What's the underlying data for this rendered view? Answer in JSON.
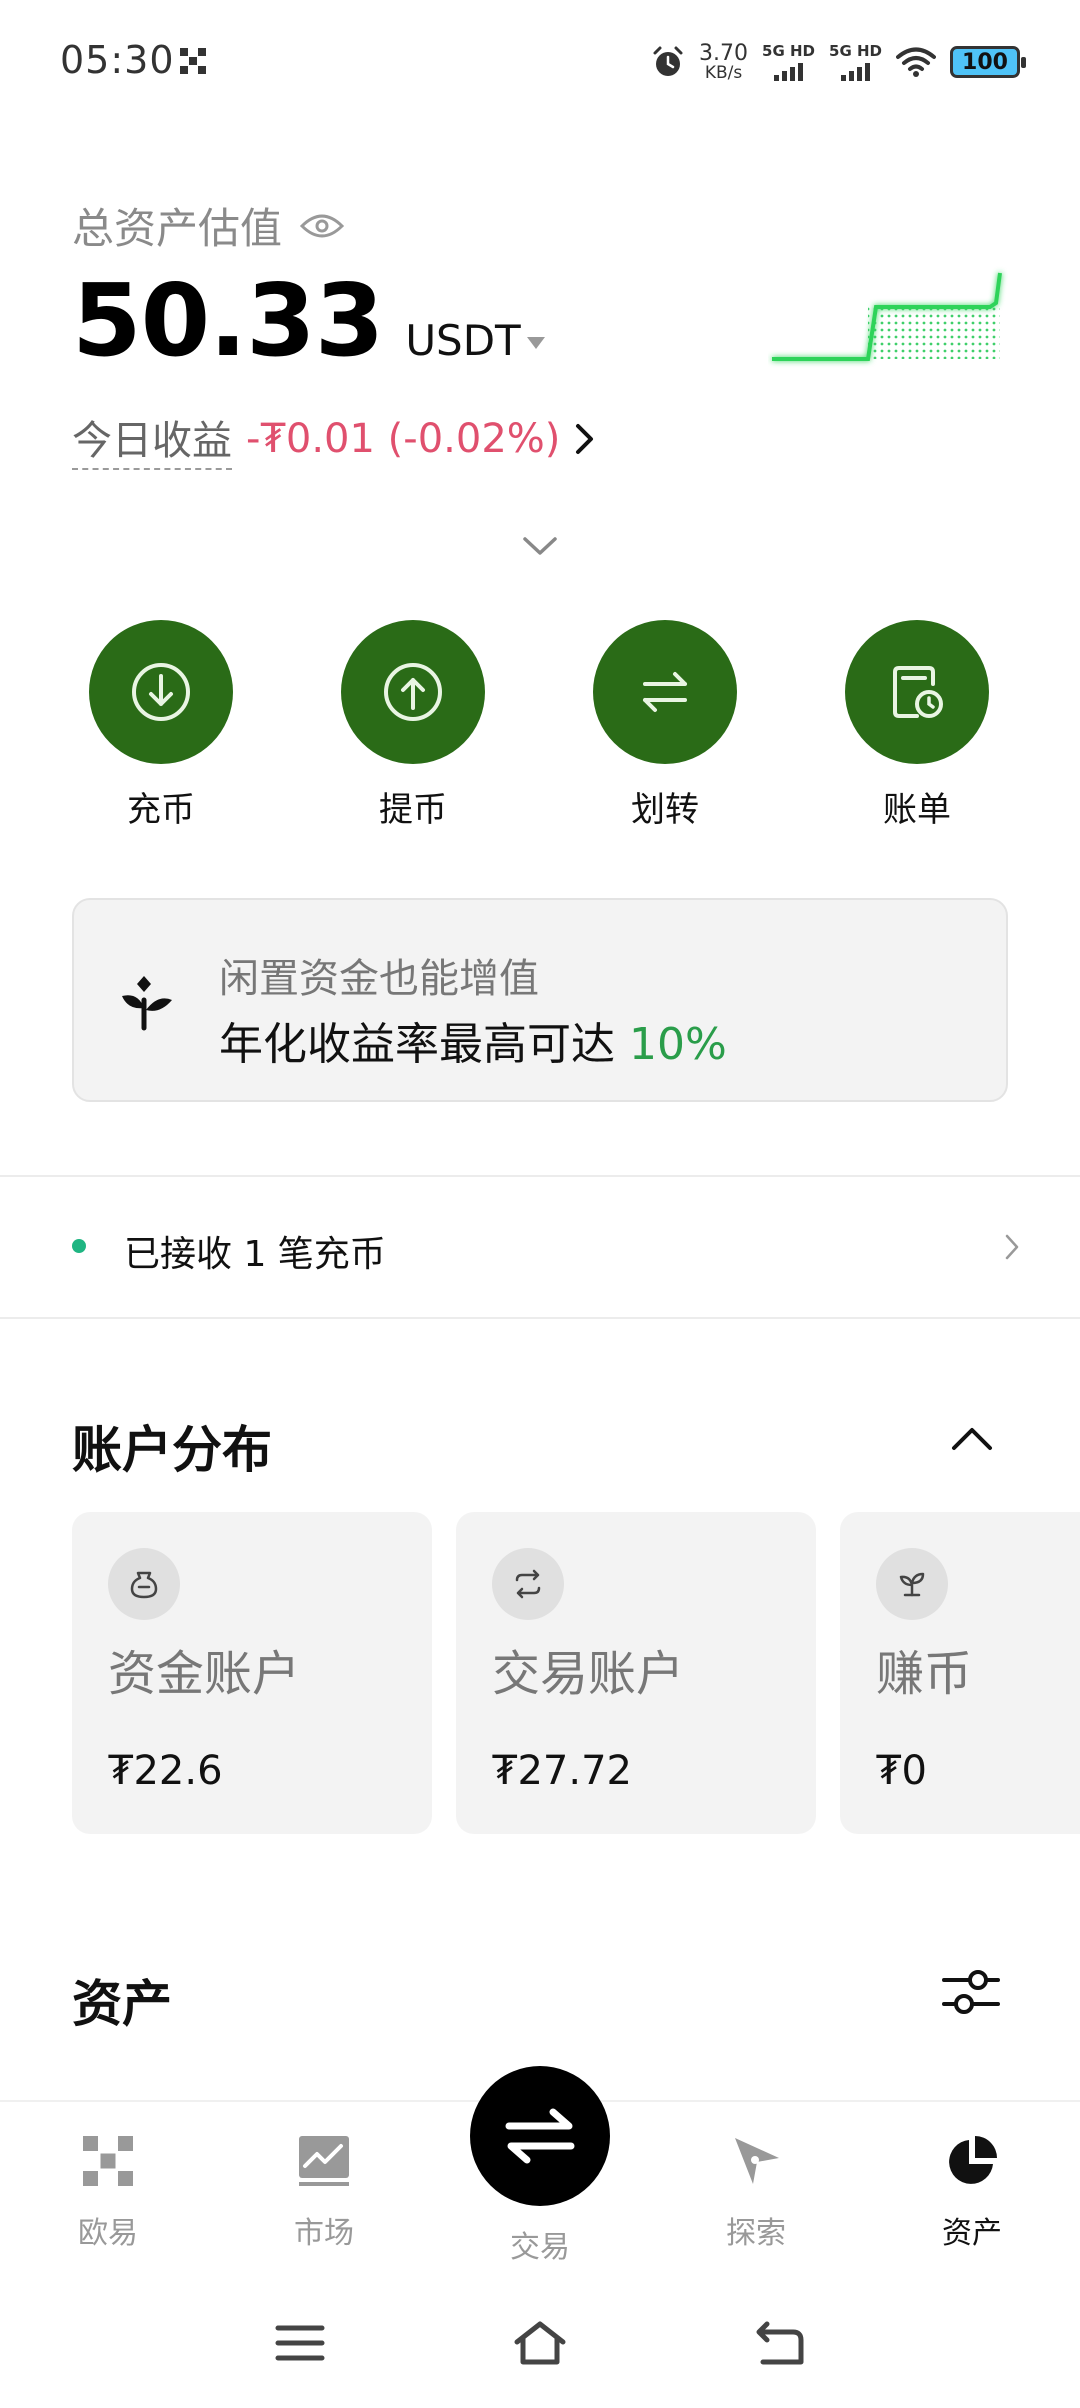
{
  "status_bar": {
    "time": "05:30",
    "net_speed_value": "3.70",
    "net_speed_unit": "KB/s",
    "sim1": "5G HD",
    "sim2": "5G HD",
    "battery": "100"
  },
  "summary": {
    "label": "总资产估值",
    "total": "50.33",
    "currency": "USDT",
    "pnl_label": "今日收益",
    "pnl_value": "-₮0.01 (-0.02%)"
  },
  "actions": [
    {
      "label": "充币",
      "icon": "deposit-icon"
    },
    {
      "label": "提币",
      "icon": "withdraw-icon"
    },
    {
      "label": "划转",
      "icon": "transfer-icon"
    },
    {
      "label": "账单",
      "icon": "bill-icon"
    }
  ],
  "promo": {
    "subtitle": "闲置资金也能增值",
    "title_prefix": "年化收益率最高可达 ",
    "title_highlight": "10%"
  },
  "notice": {
    "text": "已接收 1 笔充币"
  },
  "accounts": {
    "title": "账户分布",
    "cards": [
      {
        "name": "资金账户",
        "value": "₮22.6",
        "icon": "wallet-icon"
      },
      {
        "name": "交易账户",
        "value": "₮27.72",
        "icon": "swap-icon"
      },
      {
        "name": "赚币",
        "value": "₮0",
        "icon": "sprout-icon"
      }
    ]
  },
  "assets": {
    "title": "资产"
  },
  "bottom_nav": {
    "items": [
      {
        "label": "欧易",
        "icon": "okx-logo-icon"
      },
      {
        "label": "市场",
        "icon": "market-chart-icon"
      },
      {
        "label": "交易",
        "icon": "trade-swap-icon"
      },
      {
        "label": "探索",
        "icon": "compass-icon"
      },
      {
        "label": "资产",
        "icon": "pie-chart-icon"
      }
    ],
    "active": "资产"
  },
  "colors": {
    "accent_green": "#2a6b17",
    "negative": "#e0506e",
    "highlight_green": "#2a9d4a",
    "notice_dot": "#1fb582"
  }
}
